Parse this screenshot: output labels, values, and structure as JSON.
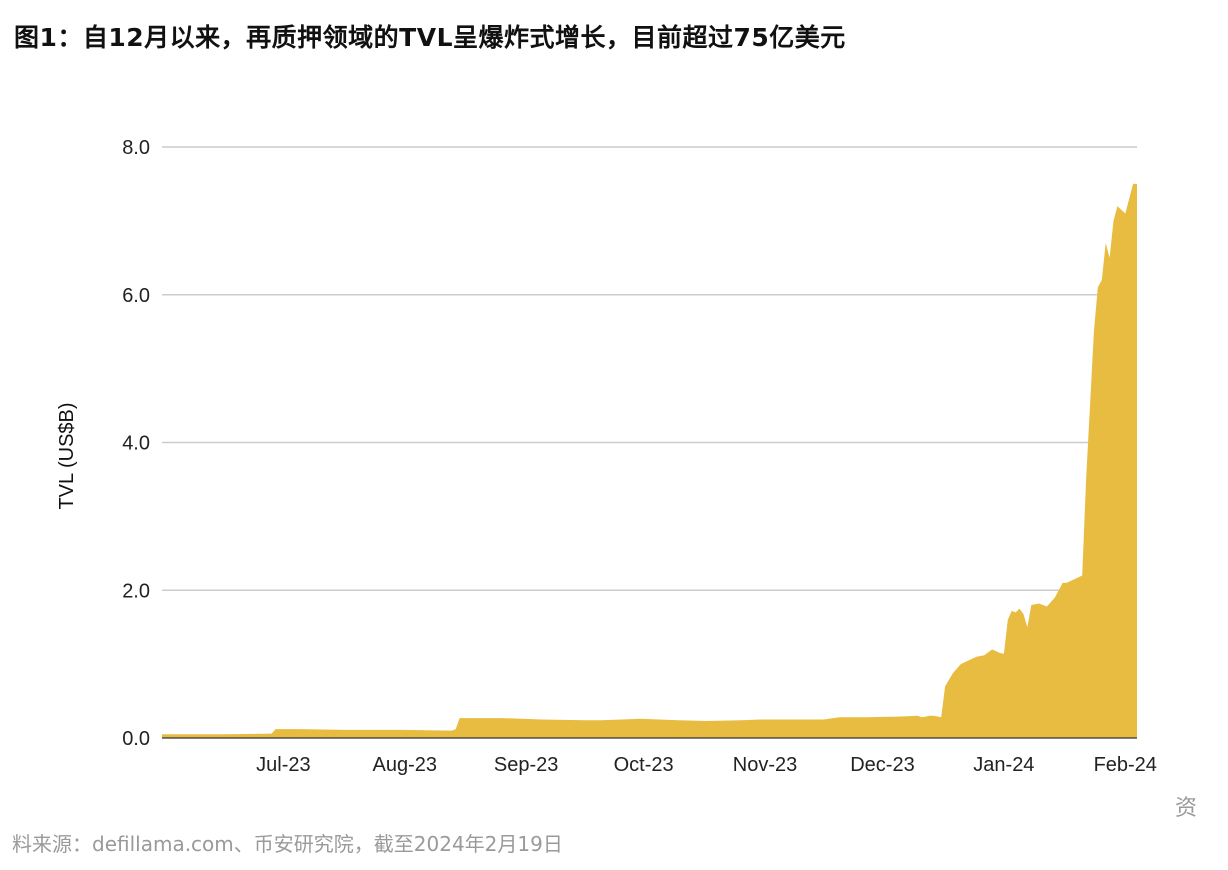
{
  "figure": {
    "title": "图1：自12月以来，再质押领域的TVL呈爆炸式增长，目前超过75亿美元",
    "source": "料来源：defillama.com、币安研究院，截至2024年2月19日",
    "cut_char": "资"
  },
  "chart_data": {
    "type": "area",
    "title": "",
    "xlabel": "",
    "ylabel": "TVL (US$B)",
    "ylim": [
      0,
      8
    ],
    "yticks": [
      0,
      2,
      4,
      6,
      8
    ],
    "ytick_labels": [
      "0.0",
      "2.0",
      "4.0",
      "6.0",
      "8.0"
    ],
    "xlim": [
      "2023-06-15",
      "2024-02-19"
    ],
    "xticks": [
      {
        "label": "Jul-23",
        "date": "2023-07-01"
      },
      {
        "label": "Aug-23",
        "date": "2023-08-01"
      },
      {
        "label": "Sep-23",
        "date": "2023-09-01"
      },
      {
        "label": "Oct-23",
        "date": "2023-10-01"
      },
      {
        "label": "Nov-23",
        "date": "2023-11-01"
      },
      {
        "label": "Dec-23",
        "date": "2023-12-01"
      },
      {
        "label": "Jan-24",
        "date": "2024-01-01"
      },
      {
        "label": "Feb-24",
        "date": "2024-02-01"
      }
    ],
    "grid": true,
    "color": "#E8BC41",
    "series": [
      {
        "x": [
          "2023-06-15",
          "2023-07-01",
          "2023-07-13",
          "2023-07-14",
          "2023-07-20",
          "2023-08-01",
          "2023-08-15",
          "2023-08-28",
          "2023-08-29",
          "2023-08-30",
          "2023-09-10",
          "2023-09-20",
          "2023-10-01",
          "2023-10-05",
          "2023-10-15",
          "2023-10-25",
          "2023-11-01",
          "2023-11-10",
          "2023-11-15",
          "2023-11-25",
          "2023-12-01",
          "2023-12-05",
          "2023-12-10",
          "2023-12-12",
          "2023-12-20",
          "2023-12-25",
          "2023-12-26",
          "2023-12-27",
          "2023-12-28",
          "2023-12-29",
          "2023-12-31",
          "2024-01-01",
          "2024-01-03",
          "2024-01-05",
          "2024-01-07",
          "2024-01-09",
          "2024-01-11",
          "2024-01-13",
          "2024-01-15",
          "2024-01-16",
          "2024-01-17",
          "2024-01-18",
          "2024-01-19",
          "2024-01-20",
          "2024-01-21",
          "2024-01-22",
          "2024-01-23",
          "2024-01-25",
          "2024-01-27",
          "2024-01-29",
          "2024-01-31",
          "2024-02-01",
          "2024-02-03",
          "2024-02-05",
          "2024-02-06",
          "2024-02-07",
          "2024-02-08",
          "2024-02-09",
          "2024-02-10",
          "2024-02-11",
          "2024-02-12",
          "2024-02-13",
          "2024-02-14",
          "2024-02-15",
          "2024-02-16",
          "2024-02-17",
          "2024-02-18",
          "2024-02-19"
        ],
        "y": [
          0.05,
          0.05,
          0.06,
          0.12,
          0.12,
          0.11,
          0.11,
          0.1,
          0.12,
          0.27,
          0.27,
          0.25,
          0.24,
          0.24,
          0.26,
          0.24,
          0.23,
          0.24,
          0.25,
          0.25,
          0.25,
          0.28,
          0.28,
          0.28,
          0.29,
          0.3,
          0.28,
          0.29,
          0.3,
          0.3,
          0.28,
          0.7,
          0.88,
          1.0,
          1.05,
          1.1,
          1.12,
          1.2,
          1.15,
          1.14,
          1.6,
          1.72,
          1.7,
          1.75,
          1.68,
          1.5,
          1.8,
          1.82,
          1.78,
          1.9,
          2.1,
          2.1,
          2.15,
          2.2,
          3.5,
          4.5,
          5.5,
          6.1,
          6.2,
          6.7,
          6.5,
          7.0,
          7.2,
          7.15,
          7.1,
          7.3,
          7.5,
          7.5
        ]
      }
    ]
  }
}
